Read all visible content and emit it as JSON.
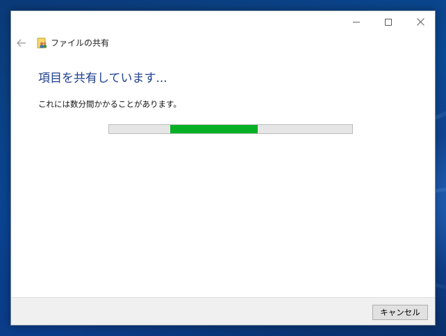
{
  "window": {
    "title": "ファイルの共有",
    "controls": {
      "minimize_icon": "minimize-icon",
      "maximize_icon": "maximize-icon",
      "close_icon": "close-icon"
    }
  },
  "nav": {
    "back_icon": "back-arrow-icon"
  },
  "main": {
    "heading": "項目を共有しています...",
    "description": "これには数分間かかることがあります。",
    "progress": {
      "indeterminate": true,
      "segment_start_fraction": 0.25,
      "segment_end_fraction": 0.61,
      "color": "#06b025"
    }
  },
  "footer": {
    "cancel_label": "キャンセル"
  },
  "colors": {
    "heading": "#1e3f8f",
    "footer_bg": "#f0f0f0",
    "desktop": "#0a4a95"
  }
}
